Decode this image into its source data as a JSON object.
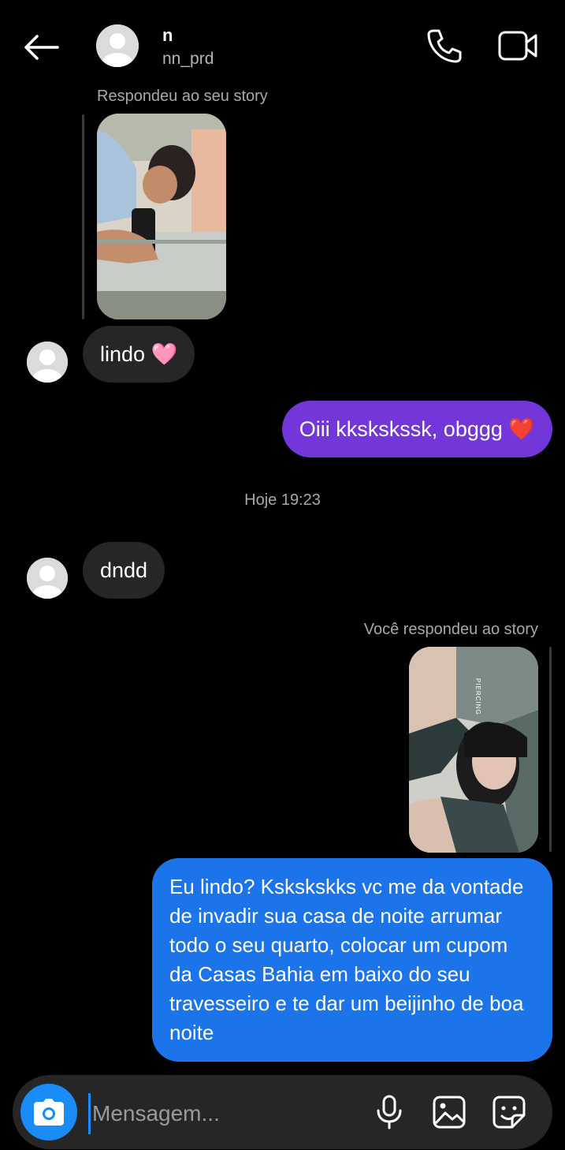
{
  "header": {
    "name": "n",
    "username": "nn_prd"
  },
  "messages": [
    {
      "type": "story_reply_caption",
      "text": "Respondeu ao seu story"
    },
    {
      "type": "incoming",
      "text": "lindo 🩷"
    },
    {
      "type": "outgoing",
      "text": "Oiii kkskskssk, obggg ❤️"
    },
    {
      "type": "timestamp",
      "text": "Hoje 19:23"
    },
    {
      "type": "incoming",
      "text": "dndd"
    },
    {
      "type": "story_reply_caption",
      "text": "Você respondeu ao story"
    },
    {
      "type": "outgoing",
      "text": "Eu lindo?  Kskskskks vc me da vontade de invadir sua casa de noite arrumar todo o seu quarto, colocar um cupom da Casas Bahia em baixo do seu travesseiro e te dar um beijinho de boa noite"
    }
  ],
  "stories": [
    {
      "overlay_text": ""
    },
    {
      "overlay_text": "PIERCING"
    }
  ],
  "composer": {
    "placeholder": "Mensagem..."
  },
  "icons": {
    "back": "arrow-left-icon",
    "call": "phone-icon",
    "video": "video-camera-icon",
    "camera": "camera-icon",
    "mic": "microphone-icon",
    "gallery": "image-icon",
    "sticker": "sticker-icon"
  },
  "colors": {
    "background": "#000000",
    "incoming_bubble": "#262626",
    "outgoing_purple": "#7236d9",
    "outgoing_blue": "#1b74ea",
    "accent": "#1a8cf7"
  }
}
